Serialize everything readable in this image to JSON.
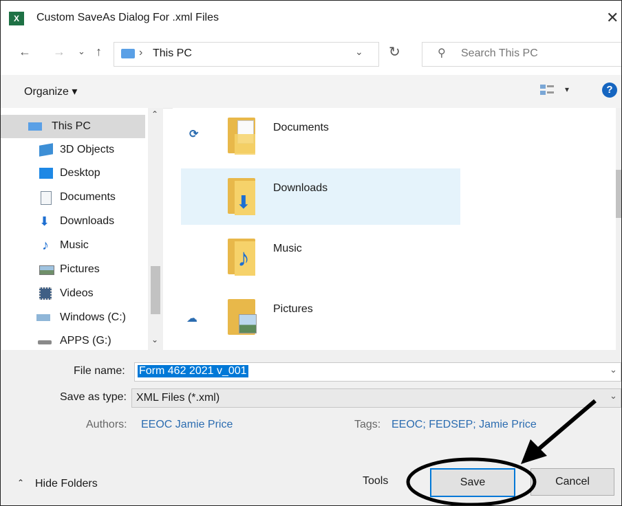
{
  "window": {
    "title": "Custom SaveAs Dialog For .xml Files",
    "app_icon": "X",
    "close_glyph": "✕"
  },
  "address_bar": {
    "path": "This PC",
    "search_placeholder": "Search This PC"
  },
  "toolbar": {
    "organize_label": "Organize ▾",
    "help_glyph": "?"
  },
  "sidebar": {
    "items": [
      {
        "label": "This PC",
        "icon": "pc-icon",
        "selected": true
      },
      {
        "label": "3D Objects",
        "icon": "cube-icon"
      },
      {
        "label": "Desktop",
        "icon": "desktop-icon"
      },
      {
        "label": "Documents",
        "icon": "document-icon"
      },
      {
        "label": "Downloads",
        "icon": "download-icon"
      },
      {
        "label": "Music",
        "icon": "music-icon"
      },
      {
        "label": "Pictures",
        "icon": "pictures-icon"
      },
      {
        "label": "Videos",
        "icon": "videos-icon"
      },
      {
        "label": "Windows (C:)",
        "icon": "drive-icon"
      },
      {
        "label": "APPS (G:)",
        "icon": "network-drive-icon"
      }
    ]
  },
  "folders": [
    {
      "label": "Documents",
      "status_icon": "sync-icon"
    },
    {
      "label": "Downloads",
      "status_icon": "",
      "selected": true
    },
    {
      "label": "Music",
      "status_icon": ""
    },
    {
      "label": "Pictures",
      "status_icon": "cloud-icon"
    }
  ],
  "save_panel": {
    "file_name_label": "File name:",
    "file_name_value": "Form 462 2021 v_001",
    "save_type_label": "Save as type:",
    "save_type_value": "XML Files (*.xml)",
    "authors_label": "Authors:",
    "authors_value": "EEOC Jamie Price",
    "tags_label": "Tags:",
    "tags_value": "EEOC; FEDSEP; Jamie Price",
    "hide_folders_label": "Hide Folders",
    "tools_label": "Tools",
    "save_label": "Save",
    "cancel_label": "Cancel"
  },
  "colors": {
    "accent": "#0078d7",
    "selection": "#e5f3fb",
    "link": "#2b6cb0",
    "annotation": "#000000"
  }
}
